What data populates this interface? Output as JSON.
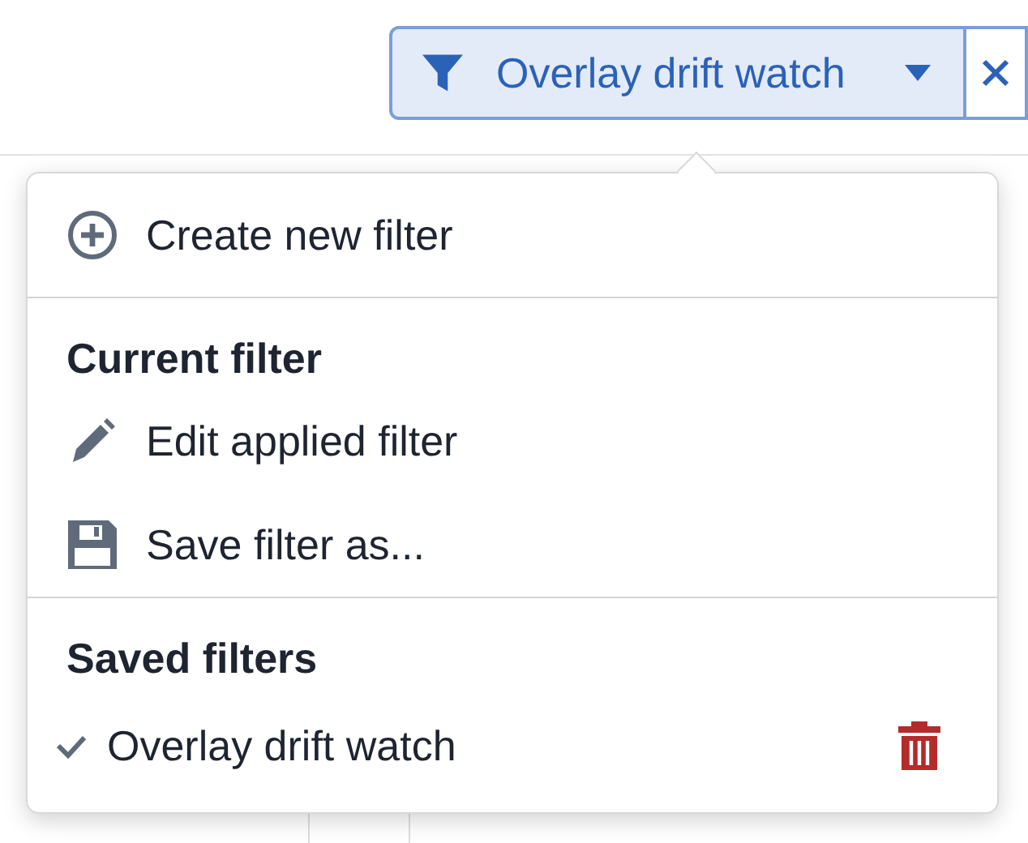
{
  "filter_button": {
    "label": "Overlay drift watch"
  },
  "menu": {
    "create_item": {
      "label": "Create new filter"
    },
    "sections": [
      {
        "heading": "Current filter",
        "items": [
          {
            "kind": "edit",
            "label": "Edit applied filter"
          },
          {
            "kind": "save",
            "label": "Save filter as..."
          }
        ]
      },
      {
        "heading": "Saved filters",
        "items": [
          {
            "kind": "saved",
            "label": "Overlay drift watch",
            "selected": true
          }
        ]
      }
    ]
  }
}
